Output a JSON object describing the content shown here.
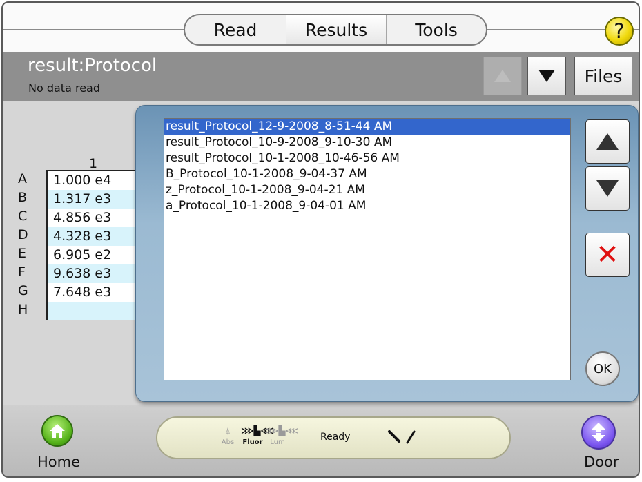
{
  "tabs": [
    {
      "label": "Read"
    },
    {
      "label": "Results"
    },
    {
      "label": "Tools"
    }
  ],
  "help": {
    "label": "?"
  },
  "header": {
    "title": "result:Protocol",
    "subtitle": "No data read",
    "files_label": "Files"
  },
  "grid": {
    "column_header": "1",
    "rows": [
      {
        "label": "A",
        "value": "1.000 e4"
      },
      {
        "label": "B",
        "value": "1.317 e3"
      },
      {
        "label": "C",
        "value": "4.856 e3"
      },
      {
        "label": "D",
        "value": "4.328 e3"
      },
      {
        "label": "E",
        "value": "6.905 e2"
      },
      {
        "label": "F",
        "value": "9.638 e3"
      },
      {
        "label": "G",
        "value": "7.648 e3"
      },
      {
        "label": "H",
        "value": ""
      }
    ]
  },
  "dialog": {
    "files": [
      "result_Protocol_12-9-2008_8-51-44 AM",
      "result_Protocol_10-9-2008_9-10-30 AM",
      "result_Protocol_10-1-2008_10-46-56 AM",
      "B_Protocol_10-1-2008_9-04-37 AM",
      "z_Protocol_10-1-2008_9-04-21 AM",
      "a_Protocol_10-1-2008_9-04-01 AM"
    ],
    "selected_index": 0,
    "ok_label": "OK"
  },
  "bottom": {
    "home_label": "Home",
    "door_label": "Door",
    "modes": [
      {
        "label": "Abs",
        "active": false
      },
      {
        "label": "Fluor",
        "active": true
      },
      {
        "label": "Lum",
        "active": false
      }
    ],
    "status": "Ready"
  },
  "colors": {
    "selection": "#3366cc",
    "dialog": "#9bbad2",
    "help_button": "#f0d90c",
    "home_button": "#55b21a",
    "door_button": "#7a55ef",
    "delete_icon": "#e01010"
  }
}
